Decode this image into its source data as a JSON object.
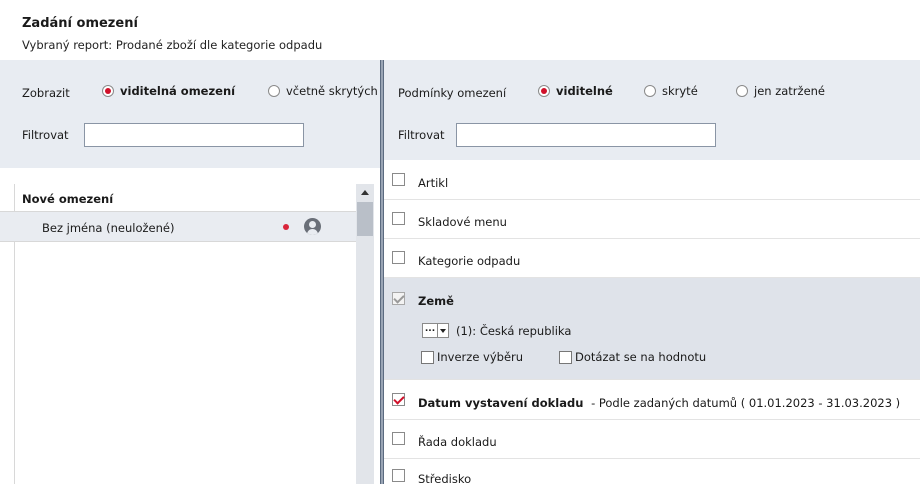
{
  "header": {
    "title": "Zadání omezení",
    "subtitle": "Vybraný report: Prodané zboží dle kategorie odpadu"
  },
  "left_toolbar": {
    "show_label": "Zobrazit",
    "radio_visible": "viditelná omezení",
    "radio_hidden": "včetně skrytých",
    "filter_label": "Filtrovat",
    "filter_value": ""
  },
  "right_toolbar": {
    "conditions_label": "Podmínky omezení",
    "radio_visible": "viditelné",
    "radio_hidden": "skryté",
    "radio_marked": "jen zatržené",
    "filter_label": "Filtrovat",
    "filter_value": ""
  },
  "left_list": {
    "header": "Nové omezení",
    "items": [
      {
        "label": "Bez jména (neuložené)"
      }
    ]
  },
  "conditions": {
    "artikl": "Artikl",
    "skladove_menu": "Skladové menu",
    "kategorie": "Kategorie odpadu",
    "zeme": {
      "label": "Země",
      "dropdown": "...",
      "value": "(1): Česká republika",
      "invert": "Inverze výběru",
      "ask": "Dotázat se na hodnotu"
    },
    "datum": {
      "label": "Datum vystavení dokladu",
      "detail": "- Podle zadaných datumů ( 01.01.2023 - 31.03.2023 )"
    },
    "rada": "Řada dokladu",
    "stredisko": "Středisko"
  },
  "colors": {
    "accent": "#d0102a",
    "toolbar_bg": "#e8ecf2",
    "selected_row": "#dfe3ea"
  }
}
